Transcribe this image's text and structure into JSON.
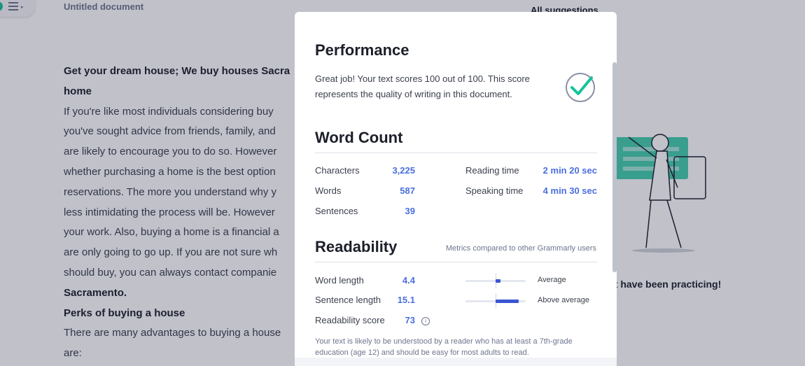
{
  "document": {
    "title": "Untitled document",
    "all_suggestions": "All suggestions",
    "lines": [
      "Get your dream house; We buy houses Sacra",
      "home",
      "If you're like most individuals considering buy",
      "you've sought advice from friends, family, and",
      "are likely to encourage you to do so. However",
      "whether purchasing a home is the best option",
      "reservations. The more you understand why y",
      "less intimidating the process will be. However",
      "your work. Also, buying a home is a financial a",
      "are only going to go up. If you are not sure wh",
      "should buy, you can always contact companie",
      "Sacramento.",
      "Perks of buying a house",
      "There are many advantages to buying a house",
      "are:"
    ],
    "right_panel_text": "st have been practicing!"
  },
  "modal": {
    "performance": {
      "title": "Performance",
      "text": "Great job! Your text scores 100 out of 100. This score represents the quality of writing in this document."
    },
    "word_count": {
      "title": "Word Count",
      "characters_label": "Characters",
      "characters_value": "3,225",
      "words_label": "Words",
      "words_value": "587",
      "sentences_label": "Sentences",
      "sentences_value": "39",
      "reading_time_label": "Reading time",
      "reading_time_value": "2 min 20 sec",
      "speaking_time_label": "Speaking time",
      "speaking_time_value": "4 min 30 sec"
    },
    "readability": {
      "title": "Readability",
      "subtitle": "Metrics compared to other Grammarly users",
      "word_length_label": "Word length",
      "word_length_value": "4.4",
      "word_length_rating": "Average",
      "sentence_length_label": "Sentence length",
      "sentence_length_value": "15.1",
      "sentence_length_rating": "Above average",
      "score_label": "Readability score",
      "score_value": "73",
      "note": "Your text is likely to be understood by a reader who has at least a 7th-grade education (age 12) and should be easy for most adults to read."
    }
  },
  "colors": {
    "accent_blue": "#4a6ee0",
    "check_green": "#15c39a"
  }
}
